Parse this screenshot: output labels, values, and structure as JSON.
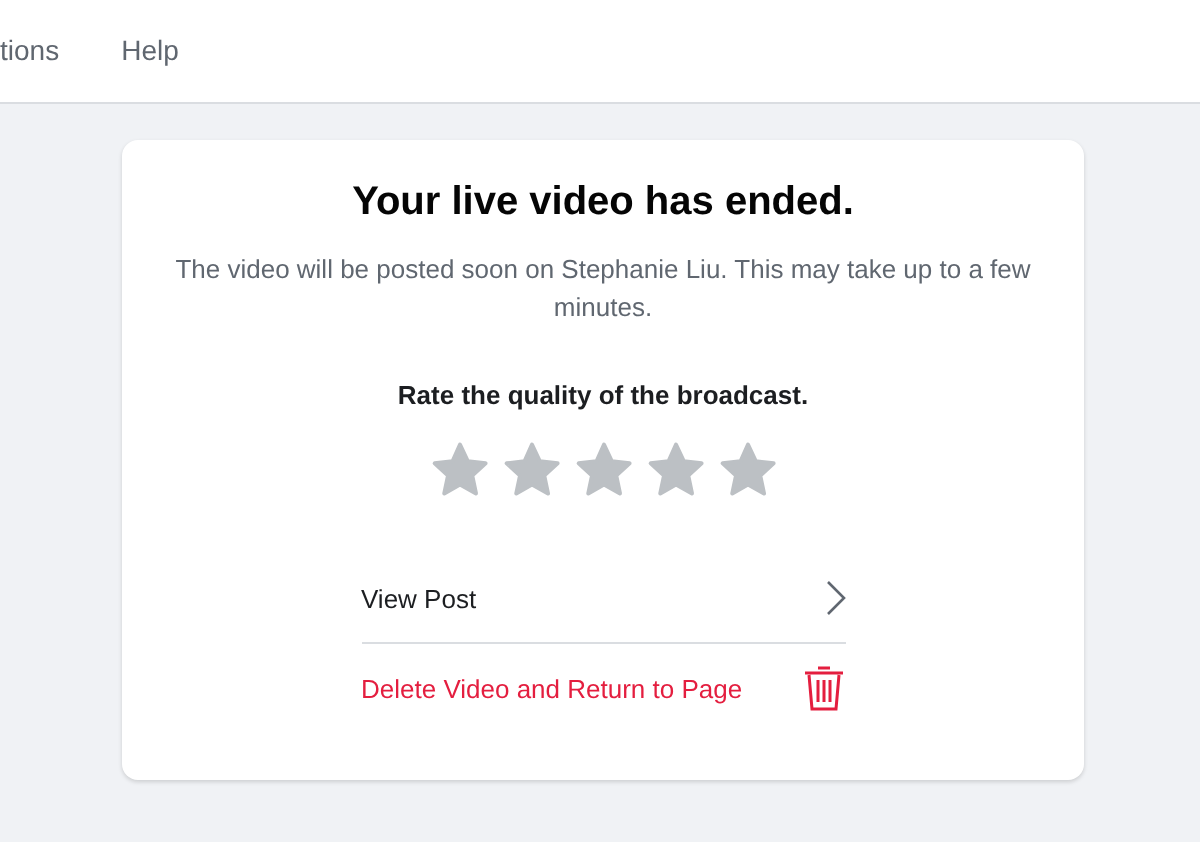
{
  "nav": {
    "items": [
      "tions",
      "Help"
    ]
  },
  "dialog": {
    "title": "Your live video has ended.",
    "message": "The video will be posted soon on Stephanie Liu. This may take up to a few minutes.",
    "rating": {
      "label": "Rate the quality of the broadcast.",
      "stars": 0
    },
    "actions": [
      {
        "kind": "link",
        "label": "View Post"
      },
      {
        "kind": "danger",
        "label": "Delete Video and Return to Page"
      }
    ]
  }
}
